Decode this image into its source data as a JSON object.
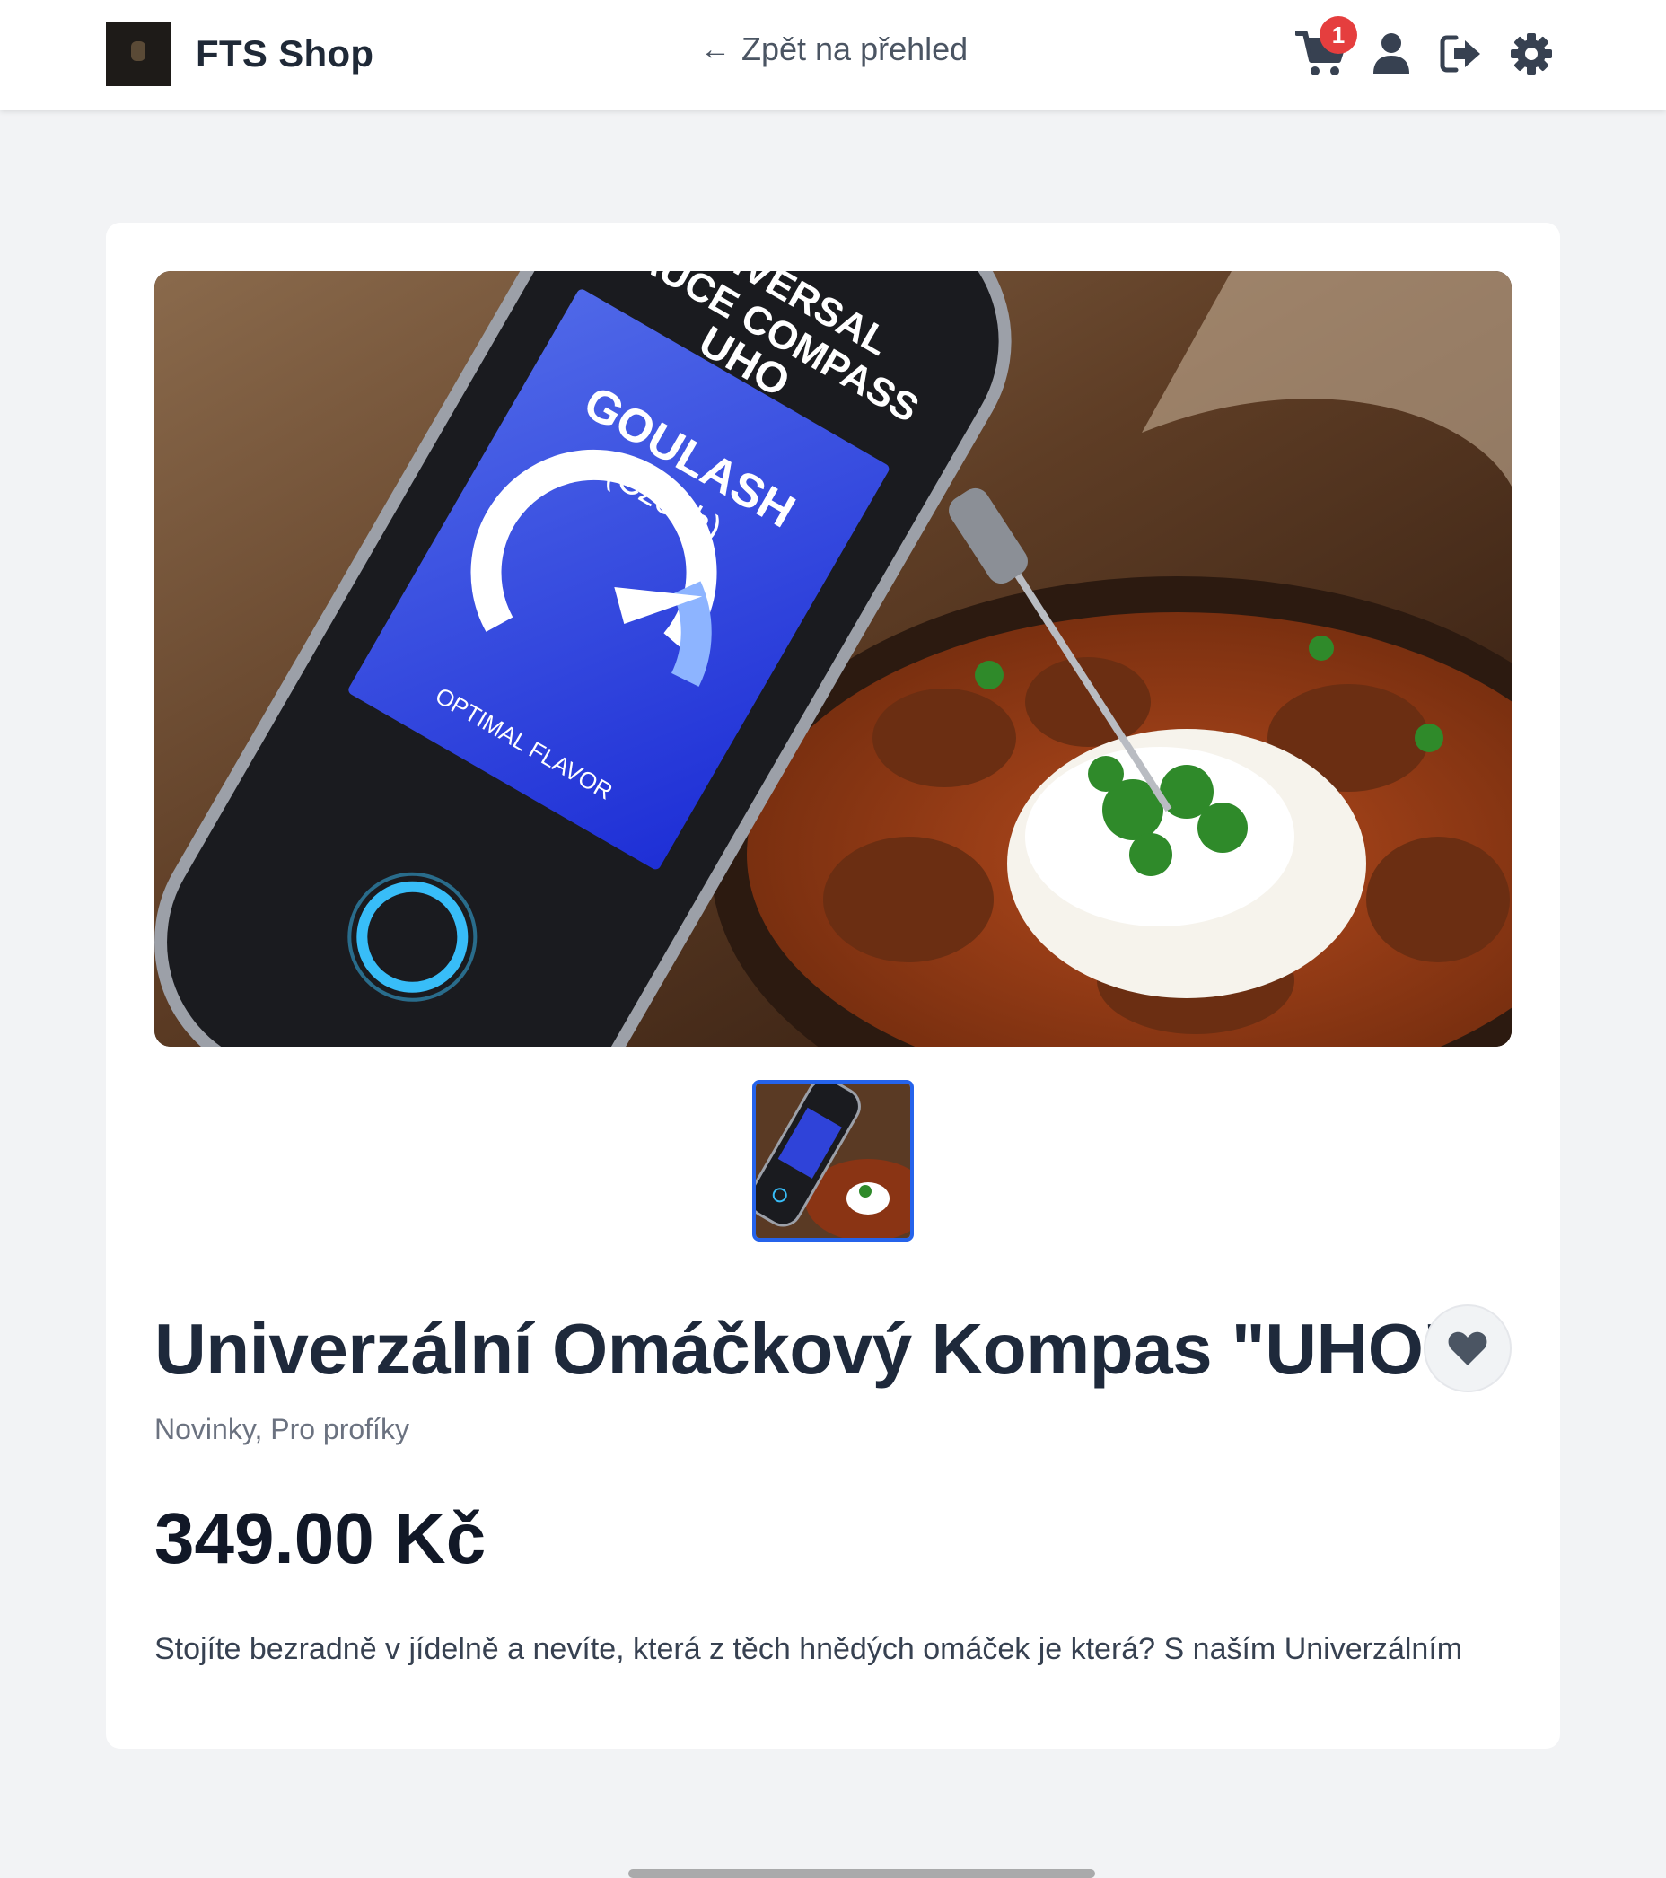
{
  "header": {
    "shop_name": "FTS Shop",
    "back_link": "Zpět na přehled",
    "back_arrow": "←",
    "cart_count": "1",
    "icons": [
      "cart-icon",
      "user-icon",
      "logout-icon",
      "settings-icon"
    ]
  },
  "product": {
    "title": "Univerzální Omáčkový Kompas \"UHO\"",
    "categories": "Novinky, Pro profíky",
    "price": "349.00 Kč",
    "description": "Stojíte bezradně v jídelně a nevíte, která z těch hnědých omáček je která? S naším Univerzálním"
  },
  "image_text": {
    "device_line1": "UNIVERSAL",
    "device_line2": "SAUCE COMPASS",
    "device_line3": "UHO",
    "screen_dish": "GOULASH",
    "screen_origin": "(Czech)",
    "screen_status": "OPTIMAL FLAVOR"
  },
  "colors": {
    "accent": "#2563eb",
    "badge": "#e53e3e",
    "screen_blue": "#2f43d9"
  }
}
